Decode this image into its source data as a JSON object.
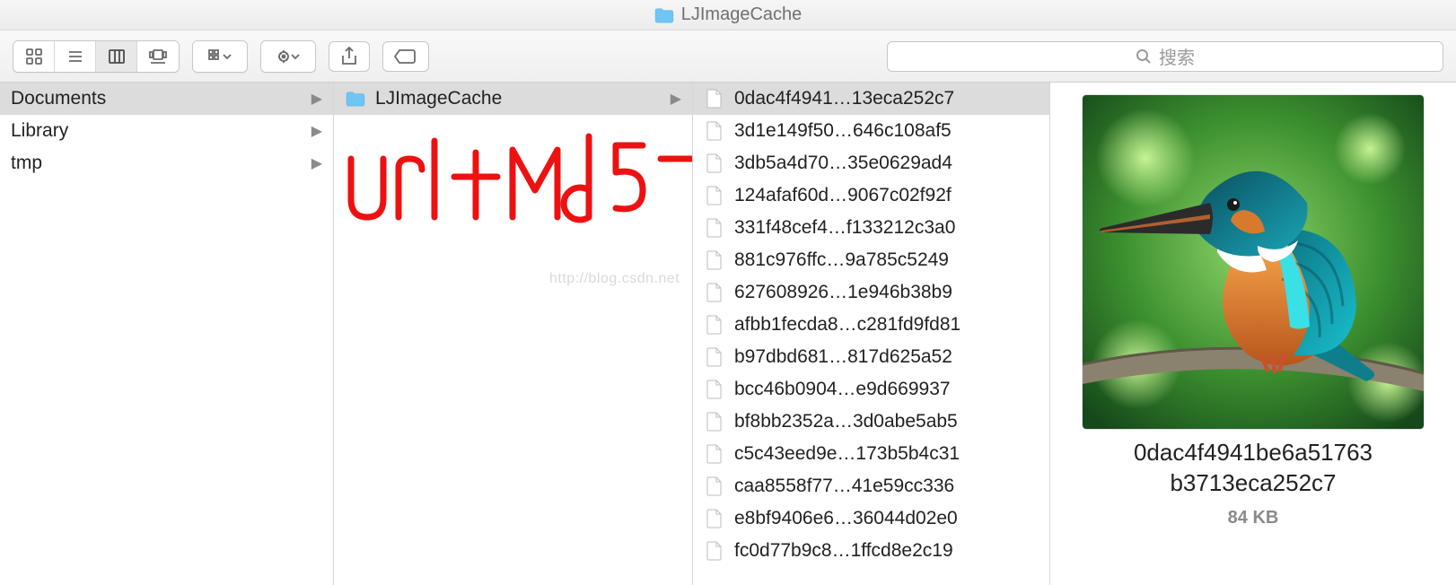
{
  "window": {
    "title": "LJImageCache"
  },
  "toolbar": {
    "search_placeholder": "搜索"
  },
  "col1": [
    {
      "name": "Documents",
      "selected": true
    },
    {
      "name": "Library",
      "selected": false
    },
    {
      "name": "tmp",
      "selected": false
    }
  ],
  "col2": [
    {
      "name": "LJImageCache",
      "selected": true
    }
  ],
  "col3": [
    {
      "name": "0dac4f4941…13eca252c7",
      "selected": true
    },
    {
      "name": "3d1e149f50…646c108af5"
    },
    {
      "name": "3db5a4d70…35e0629ad4"
    },
    {
      "name": "124afaf60d…9067c02f92f"
    },
    {
      "name": "331f48cef4…f133212c3a0"
    },
    {
      "name": "881c976ffc…9a785c5249"
    },
    {
      "name": "627608926…1e946b38b9"
    },
    {
      "name": "afbb1fecda8…c281fd9fd81"
    },
    {
      "name": "b97dbd681…817d625a52"
    },
    {
      "name": "bcc46b0904…e9d669937"
    },
    {
      "name": "bf8bb2352a…3d0abe5ab5"
    },
    {
      "name": "c5c43eed9e…173b5b4c31"
    },
    {
      "name": "caa8558f77…41e59cc336"
    },
    {
      "name": "e8bf9406e6…36044d02e0"
    },
    {
      "name": "fc0d77b9c8…1ffcd8e2c19"
    }
  ],
  "preview": {
    "filename_line1": "0dac4f4941be6a51763",
    "filename_line2": "b3713eca252c7",
    "size": "84 KB"
  },
  "annotation": "url+md5",
  "watermark": "http://blog.csdn.net"
}
